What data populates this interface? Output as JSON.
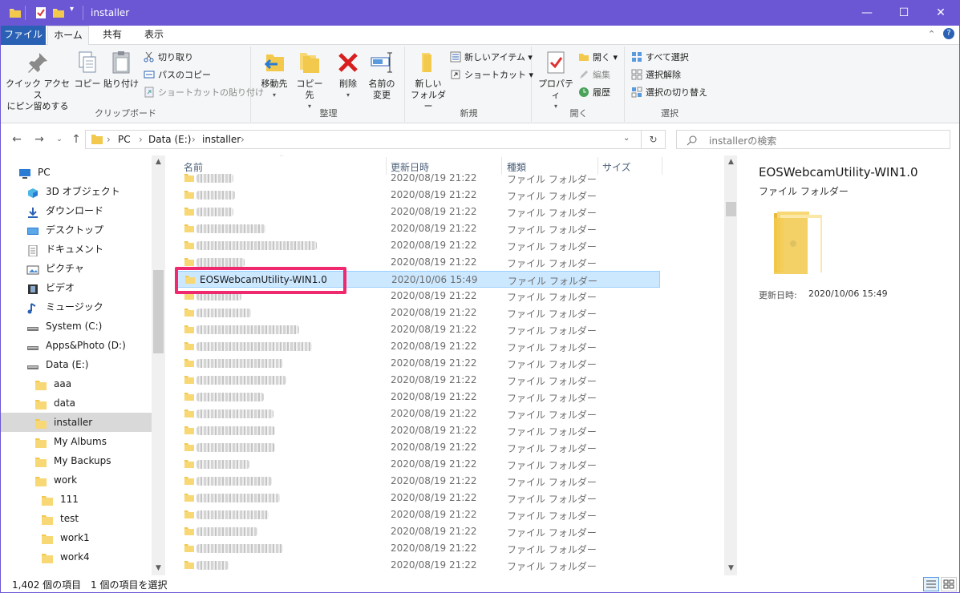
{
  "window": {
    "title": "installer",
    "controls": {
      "minimize": "—",
      "maximize": "☐",
      "close": "✕"
    }
  },
  "ribbon_tabs": [
    "ファイル",
    "ホーム",
    "共有",
    "表示"
  ],
  "ribbon": {
    "clipboard": {
      "pin_label_1": "クイック アクセス",
      "pin_label_2": "にピン留めする",
      "copy": "コピー",
      "paste": "貼り付け",
      "cut": "切り取り",
      "copy_path": "パスのコピー",
      "paste_shortcut": "ショートカットの貼り付け",
      "group": "クリップボード"
    },
    "organize": {
      "move_to": "移動先",
      "copy_to": "コピー先",
      "delete": "削除",
      "rename_1": "名前の",
      "rename_2": "変更",
      "group": "整理"
    },
    "new": {
      "new_folder_1": "新しい",
      "new_folder_2": "フォルダー",
      "new_item": "新しいアイテム",
      "shortcut": "ショートカット",
      "group": "新規"
    },
    "open": {
      "properties": "プロパティ",
      "open": "開く",
      "edit": "編集",
      "history": "履歴",
      "group": "開く"
    },
    "select": {
      "select_all": "すべて選択",
      "select_none": "選択解除",
      "invert": "選択の切り替え",
      "group": "選択"
    }
  },
  "address": {
    "crumbs": [
      "PC",
      "Data (E:)",
      "installer"
    ],
    "search_placeholder": "installerの検索"
  },
  "nav_pane": [
    {
      "label": "PC",
      "icon": "pc-icon"
    },
    {
      "label": "3D オブジェクト",
      "icon": "3d-objects-icon"
    },
    {
      "label": "ダウンロード",
      "icon": "download-icon"
    },
    {
      "label": "デスクトップ",
      "icon": "desktop-icon"
    },
    {
      "label": "ドキュメント",
      "icon": "document-icon"
    },
    {
      "label": "ピクチャ",
      "icon": "pictures-icon"
    },
    {
      "label": "ビデオ",
      "icon": "video-icon"
    },
    {
      "label": "ミュージック",
      "icon": "music-icon"
    },
    {
      "label": "System (C:)",
      "icon": "drive-icon"
    },
    {
      "label": "Apps&Photo (D:)",
      "icon": "drive-icon"
    },
    {
      "label": "Data (E:)",
      "icon": "drive-icon"
    },
    {
      "label": "aaa",
      "icon": "folder-icon"
    },
    {
      "label": "data",
      "icon": "folder-icon"
    },
    {
      "label": "installer",
      "icon": "folder-icon"
    },
    {
      "label": "My Albums",
      "icon": "folder-icon"
    },
    {
      "label": "My Backups",
      "icon": "folder-icon"
    },
    {
      "label": "work",
      "icon": "folder-icon"
    },
    {
      "label": "111",
      "icon": "folder-icon"
    },
    {
      "label": "test",
      "icon": "folder-icon"
    },
    {
      "label": "work1",
      "icon": "folder-icon"
    },
    {
      "label": "work4",
      "icon": "folder-icon"
    }
  ],
  "columns": {
    "name": "名前",
    "modified": "更新日時",
    "type": "種類",
    "size": "サイズ"
  },
  "files": [
    {
      "name": "",
      "date": "2020/08/19 21:22",
      "type": "ファイル フォルダー"
    },
    {
      "name": "",
      "date": "2020/08/19 21:22",
      "type": "ファイル フォルダー"
    },
    {
      "name": "",
      "date": "2020/08/19 21:22",
      "type": "ファイル フォルダー"
    },
    {
      "name": "",
      "date": "2020/08/19 21:22",
      "type": "ファイル フォルダー"
    },
    {
      "name": "",
      "date": "2020/08/19 21:22",
      "type": "ファイル フォルダー"
    },
    {
      "name": "",
      "date": "2020/08/19 21:22",
      "type": "ファイル フォルダー"
    },
    {
      "name": "EOSWebcamUtility-WIN1.0",
      "date": "2020/10/06 15:49",
      "type": "ファイル フォルダー",
      "selected": true
    },
    {
      "name": "",
      "date": "2020/08/19 21:22",
      "type": "ファイル フォルダー"
    },
    {
      "name": "",
      "date": "2020/08/19 21:22",
      "type": "ファイル フォルダー"
    },
    {
      "name": "",
      "date": "2020/08/19 21:22",
      "type": "ファイル フォルダー"
    },
    {
      "name": "",
      "date": "2020/08/19 21:22",
      "type": "ファイル フォルダー"
    },
    {
      "name": "",
      "date": "2020/08/19 21:22",
      "type": "ファイル フォルダー"
    },
    {
      "name": "",
      "date": "2020/08/19 21:22",
      "type": "ファイル フォルダー"
    },
    {
      "name": "",
      "date": "2020/08/19 21:22",
      "type": "ファイル フォルダー"
    },
    {
      "name": "",
      "date": "2020/08/19 21:22",
      "type": "ファイル フォルダー"
    },
    {
      "name": "",
      "date": "2020/08/19 21:22",
      "type": "ファイル フォルダー"
    },
    {
      "name": "",
      "date": "2020/08/19 21:22",
      "type": "ファイル フォルダー"
    },
    {
      "name": "",
      "date": "2020/08/19 21:22",
      "type": "ファイル フォルダー"
    },
    {
      "name": "",
      "date": "2020/08/19 21:22",
      "type": "ファイル フォルダー"
    },
    {
      "name": "",
      "date": "2020/08/19 21:22",
      "type": "ファイル フォルダー"
    },
    {
      "name": "",
      "date": "2020/08/19 21:22",
      "type": "ファイル フォルダー"
    },
    {
      "name": "",
      "date": "2020/08/19 21:22",
      "type": "ファイル フォルダー"
    },
    {
      "name": "",
      "date": "2020/08/19 21:22",
      "type": "ファイル フォルダー"
    },
    {
      "name": "",
      "date": "2020/08/19 21:22",
      "type": "ファイル フォルダー"
    },
    {
      "name": "",
      "date": "2020/08/19 21:22",
      "type": "ファイル フォルダー"
    }
  ],
  "preview": {
    "title": "EOSWebcamUtility-WIN1.0",
    "type": "ファイル フォルダー",
    "modified_label": "更新日時:",
    "modified_value": "2020/10/06 15:49"
  },
  "status": {
    "count": "1,402 個の項目",
    "selected": "1 個の項目を選択"
  },
  "colors": {
    "titlebar": "#6b57d4",
    "file_tab": "#2a61b5",
    "selection": "#cce8ff",
    "highlight_box": "#f0286e",
    "folder": "#f2c94c"
  }
}
